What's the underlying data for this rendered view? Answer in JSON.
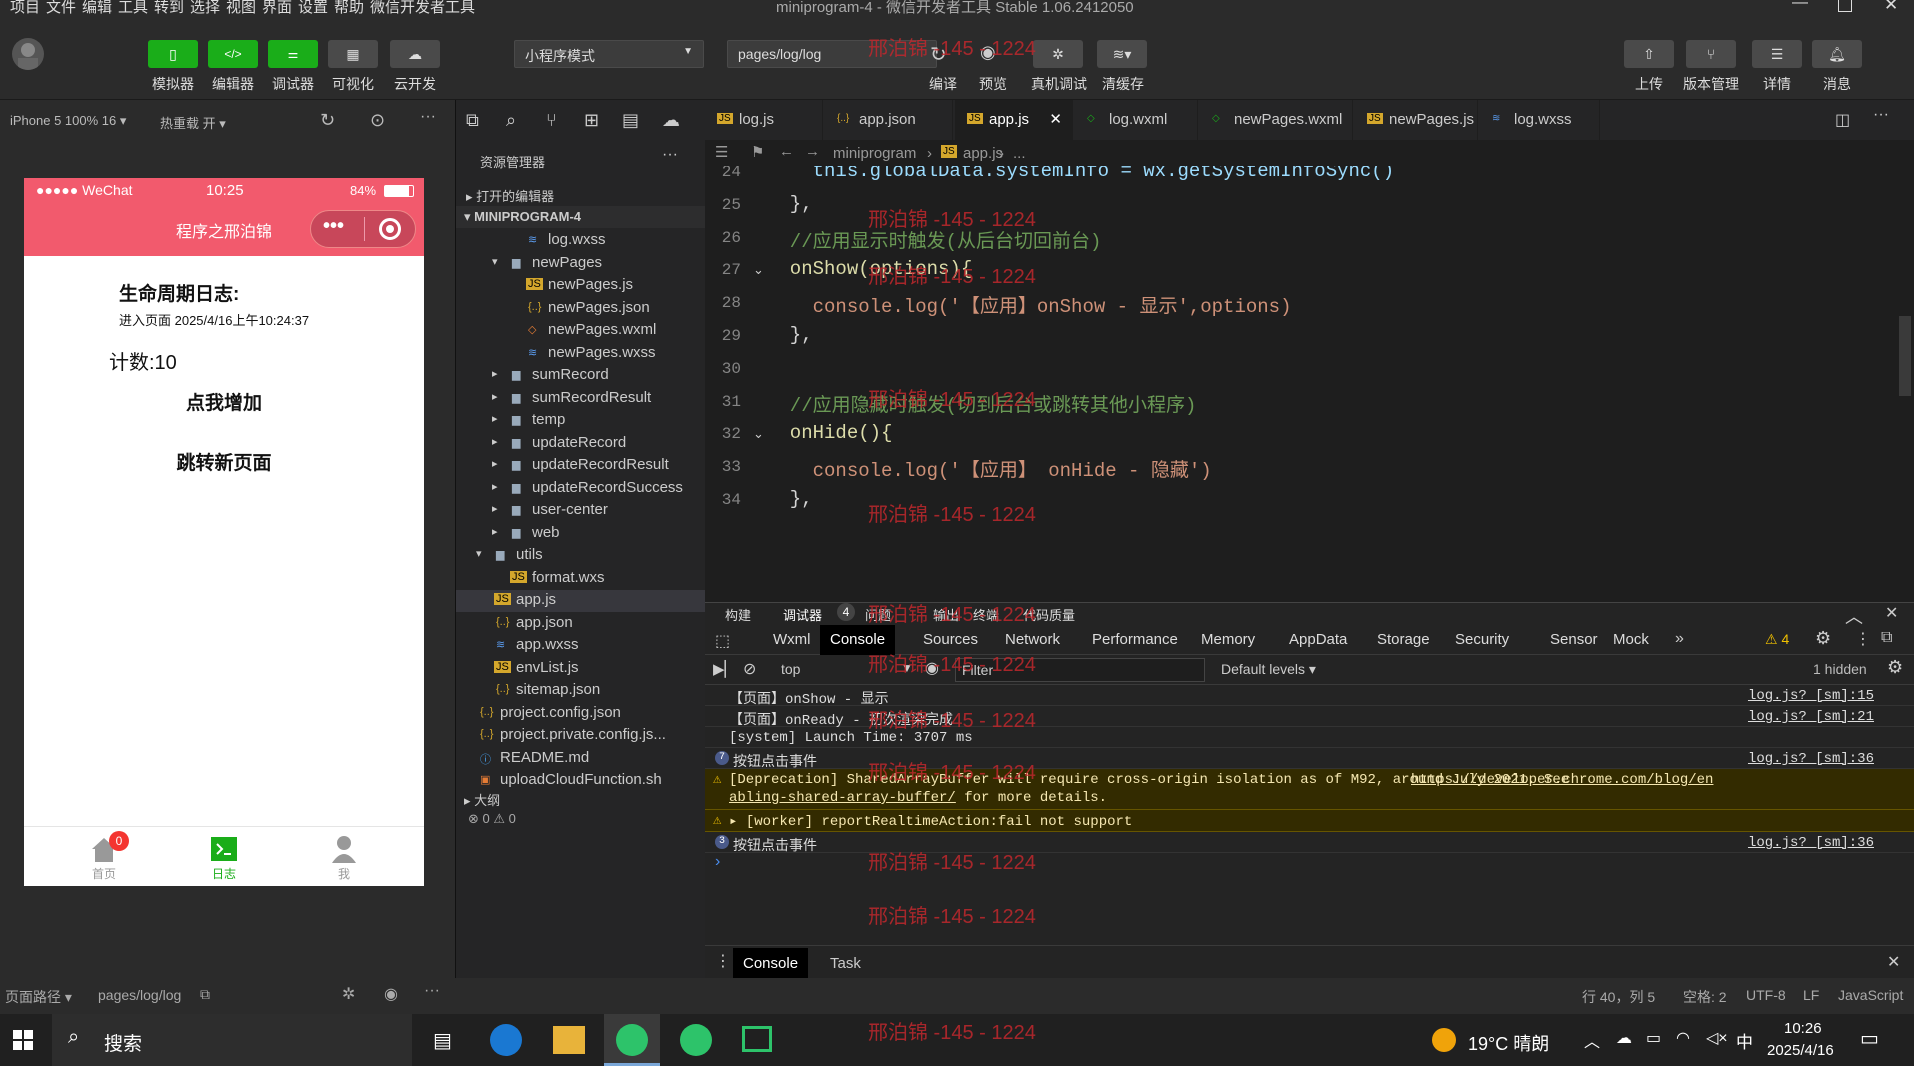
{
  "menu": [
    "项目",
    "文件",
    "编辑",
    "工具",
    "转到",
    "选择",
    "视图",
    "界面",
    "设置",
    "帮助",
    "微信开发者工具"
  ],
  "window_title": "miniprogram-4 - 微信开发者工具 Stable 1.06.2412050",
  "toolbar": {
    "simulator": "模拟器",
    "editor": "编辑器",
    "debugger": "调试器",
    "visual": "可视化",
    "cloud": "云开发",
    "mode": "小程序模式",
    "path": "pages/log/log",
    "compile": "编译",
    "preview": "预览",
    "realdebug": "真机调试",
    "clearcache": "清缓存",
    "upload": "上传",
    "version": "版本管理",
    "details": "详情",
    "messages": "消息"
  },
  "simbar": {
    "device": "iPhone 5 100% 16 ▾",
    "hotreload": "热重载 开 ▾"
  },
  "phone": {
    "carrier": "●●●●● WeChat",
    "time": "10:25",
    "battery": "84%",
    "nav_title": "程序之邢泊锦",
    "heading": "生命周期日志:",
    "log_line": "进入页面 2025/4/16上午10:24:37",
    "counter": "计数:10",
    "btn_add": "点我增加",
    "btn_jump": "跳转新页面",
    "tabs": [
      {
        "label": "首页",
        "badge": "0"
      },
      {
        "label": "日志"
      },
      {
        "label": "我"
      }
    ]
  },
  "explorer": {
    "title": "资源管理器",
    "open_editors": "打开的编辑器",
    "project": "MINIPROGRAM-4",
    "items": [
      {
        "name": "log.wxss",
        "type": "wxss"
      },
      {
        "name": "newPages",
        "type": "folder-open"
      },
      {
        "name": "newPages.js",
        "type": "js"
      },
      {
        "name": "newPages.json",
        "type": "json"
      },
      {
        "name": "newPages.wxml",
        "type": "wxml"
      },
      {
        "name": "newPages.wxss",
        "type": "wxss"
      },
      {
        "name": "sumRecord",
        "type": "folder"
      },
      {
        "name": "sumRecordResult",
        "type": "folder"
      },
      {
        "name": "temp",
        "type": "folder"
      },
      {
        "name": "updateRecord",
        "type": "folder"
      },
      {
        "name": "updateRecordResult",
        "type": "folder"
      },
      {
        "name": "updateRecordSuccess",
        "type": "folder"
      },
      {
        "name": "user-center",
        "type": "folder"
      },
      {
        "name": "web",
        "type": "folder"
      },
      {
        "name": "utils",
        "type": "folder-open"
      },
      {
        "name": "format.wxs",
        "type": "js"
      },
      {
        "name": "app.js",
        "type": "js"
      },
      {
        "name": "app.json",
        "type": "json"
      },
      {
        "name": "app.wxss",
        "type": "wxss"
      },
      {
        "name": "envList.js",
        "type": "js"
      },
      {
        "name": "sitemap.json",
        "type": "json"
      },
      {
        "name": "project.config.json",
        "type": "json"
      },
      {
        "name": "project.private.config.js...",
        "type": "json"
      },
      {
        "name": "README.md",
        "type": "info"
      },
      {
        "name": "uploadCloudFunction.sh",
        "type": "sh"
      }
    ],
    "outline": "大纲",
    "problems": "⊗ 0 ⚠ 0"
  },
  "editor_tabs": [
    "log.js",
    "app.json",
    "app.js",
    "log.wxml",
    "newPages.wxml",
    "newPages.js",
    "log.wxss"
  ],
  "breadcrumb": {
    "root": "miniprogram",
    "file": "app.js",
    "more": "..."
  },
  "code_lines": [
    {
      "n": "24",
      "text": "    this.globalData.systemInfo = wx.getSystemInfoSync()"
    },
    {
      "n": "25",
      "text": "  },"
    },
    {
      "n": "26",
      "text": "  //应用显示时触发(从后台切回前台)"
    },
    {
      "n": "27",
      "text": "  onShow(options){"
    },
    {
      "n": "28",
      "text": "    console.log('【应用】onShow - 显示',options)"
    },
    {
      "n": "29",
      "text": "  },"
    },
    {
      "n": "30",
      "text": ""
    },
    {
      "n": "31",
      "text": "  //应用隐藏时触发(切到后台或跳转其他小程序)"
    },
    {
      "n": "32",
      "text": "  onHide(){"
    },
    {
      "n": "33",
      "text": "    console.log('【应用】 onHide - 隐藏')"
    },
    {
      "n": "34",
      "text": "  },"
    }
  ],
  "watermark": "邢泊锦 -145 - 1224",
  "devtools": {
    "top_tabs": [
      "构建",
      "调试器",
      "问题",
      "输出",
      "终端",
      "代码质量"
    ],
    "badge": "4",
    "panel_tabs": [
      "Wxml",
      "Console",
      "Sources",
      "Network",
      "Performance",
      "Memory",
      "AppData",
      "Storage",
      "Security",
      "Sensor",
      "Mock"
    ],
    "warn_count": "⚠ 4",
    "context": "top",
    "filter_placeholder": "Filter",
    "levels": "Default levels ▾",
    "hidden": "1 hidden",
    "rows": [
      {
        "text": "【页面】onShow - 显示",
        "src": "log.js? [sm]:15",
        "kind": "log"
      },
      {
        "text": "【页面】onReady - 初次渲染完成",
        "src": "log.js? [sm]:21",
        "kind": "log"
      },
      {
        "text": "[system] Launch Time: 3707 ms",
        "src": "",
        "kind": "log"
      },
      {
        "text": "按钮点击事件",
        "src": "log.js? [sm]:36",
        "kind": "count",
        "count": "7"
      },
      {
        "text": "[Deprecation] SharedArrayBuffer will require cross-origin isolation as of M92, around July 2021. See ",
        "link": "https://developer.chrome.com/blog/en",
        "text2": "abling-shared-array-buffer/",
        "text3": " for more details.",
        "kind": "warn"
      },
      {
        "text": "▸ [worker] reportRealtimeAction:fail not support",
        "kind": "warn2"
      },
      {
        "text": "按钮点击事件",
        "src": "log.js? [sm]:36",
        "kind": "count",
        "count": "3"
      }
    ],
    "drawer_tabs": [
      "Console",
      "Task"
    ]
  },
  "statusbar": {
    "route_label": "页面路径 ▾",
    "route": "pages/log/log",
    "pos": "行 40，列 5",
    "spaces": "空格: 2",
    "enc": "UTF-8",
    "eol": "LF",
    "lang": "JavaScript"
  },
  "taskbar": {
    "search": "搜索",
    "weather": "19°C 晴朗",
    "ime": "中",
    "time": "10:26",
    "date": "2025/4/16"
  },
  "colors": {
    "accent_green": "#1aad19",
    "phone_header": "#f25a6d",
    "watermark": "#c0282d"
  }
}
